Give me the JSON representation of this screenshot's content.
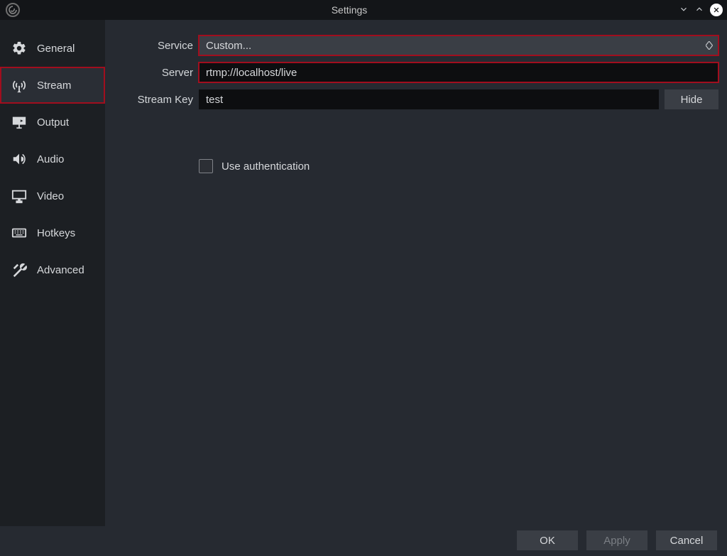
{
  "window": {
    "title": "Settings"
  },
  "sidebar": {
    "items": [
      {
        "label": "General",
        "icon": "gear"
      },
      {
        "label": "Stream",
        "icon": "antenna"
      },
      {
        "label": "Output",
        "icon": "monitor-out"
      },
      {
        "label": "Audio",
        "icon": "speaker"
      },
      {
        "label": "Video",
        "icon": "monitor"
      },
      {
        "label": "Hotkeys",
        "icon": "keyboard"
      },
      {
        "label": "Advanced",
        "icon": "wrench"
      }
    ],
    "selected_index": 1
  },
  "stream_form": {
    "service": {
      "label": "Service",
      "value": "Custom..."
    },
    "server": {
      "label": "Server",
      "value": "rtmp://localhost/live"
    },
    "streamkey": {
      "label": "Stream Key",
      "value": "test",
      "hide_button": "Hide"
    },
    "auth": {
      "label": "Use authentication",
      "checked": false
    }
  },
  "footer": {
    "ok": "OK",
    "apply": "Apply",
    "cancel": "Cancel",
    "apply_enabled": false
  },
  "colors": {
    "highlight": "#a10e1e",
    "panel_bg": "#262a31",
    "sidebar_bg": "#1c1f23",
    "input_bg": "#0d0e10"
  }
}
